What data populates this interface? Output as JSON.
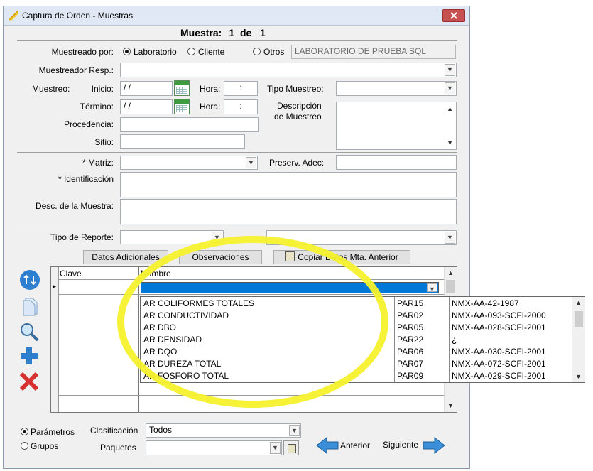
{
  "window": {
    "title": "Captura de Orden - Muestras",
    "close_icon": "close-icon"
  },
  "header": {
    "label": "Muestra:",
    "current": "1",
    "of": "de",
    "total": "1"
  },
  "muestreado_por": {
    "label": "Muestreado por:",
    "options": [
      "Laboratorio",
      "Cliente",
      "Otros"
    ],
    "selected": "Laboratorio",
    "value": "LABORATORIO DE PRUEBA SQL"
  },
  "muestreador_resp": {
    "label": "Muestreador Resp.:",
    "value": ""
  },
  "muestreo": {
    "label": "Muestreo:",
    "inicio_label": "Inicio:",
    "inicio_value": "/ /",
    "hora_label": "Hora:",
    "hora_inicio": ":",
    "termino_label": "Término:",
    "termino_value": "/ /",
    "hora_termino": ":",
    "tipo_label": "Tipo Muestreo:",
    "tipo_value": "",
    "descripcion_label_1": "Descripción",
    "descripcion_label_2": "de Muestreo"
  },
  "procedencia": {
    "label": "Procedencia:",
    "value": ""
  },
  "sitio": {
    "label": "Sitio:",
    "value": ""
  },
  "matriz": {
    "label": "* Matriz:",
    "value": ""
  },
  "preserv": {
    "label": "Preserv. Adec:",
    "value": ""
  },
  "identificacion": {
    "label": "* Identificación",
    "value": ""
  },
  "desc_muestra": {
    "label": "Desc. de la Muestra:",
    "value": ""
  },
  "tipo_reporte": {
    "label": "Tipo de Reporte:",
    "value": "",
    "value2": ""
  },
  "actions": {
    "datos_adicionales": "Datos Adicionales",
    "observaciones": "Observaciones",
    "copiar": "Copiar Datos Mta. Anterior"
  },
  "grid": {
    "columns": [
      "Clave",
      "Nombre"
    ],
    "row_indicator": "▸"
  },
  "dropdown_rows": [
    {
      "nombre": "AR COLIFORMES TOTALES",
      "clave": "PAR15",
      "norma": "NMX-AA-42-1987"
    },
    {
      "nombre": "AR CONDUCTIVIDAD",
      "clave": "PAR02",
      "norma": "NMX-AA-093-SCFI-2000"
    },
    {
      "nombre": "AR DBO",
      "clave": "PAR05",
      "norma": "NMX-AA-028-SCFI-2001"
    },
    {
      "nombre": "AR DENSIDAD",
      "clave": "PAR22",
      "norma": "¿"
    },
    {
      "nombre": "AR DQO",
      "clave": "PAR06",
      "norma": "NMX-AA-030-SCFI-2001"
    },
    {
      "nombre": "AR DUREZA TOTAL",
      "clave": "PAR07",
      "norma": "NMX-AA-072-SCFI-2001"
    },
    {
      "nombre": "AR FOSFORO TOTAL",
      "clave": "PAR09",
      "norma": "NMX-AA-029-SCFI-2001"
    }
  ],
  "bottom": {
    "radio_parametros": "Parámetros",
    "radio_grupos": "Grupos",
    "selected": "Parámetros",
    "clasificacion_label": "Clasificación",
    "clasificacion_value": "Todos",
    "paquetes_label": "Paquetes",
    "paquetes_value": "",
    "anterior": "Anterior",
    "siguiente": "Siguiente"
  },
  "colors": {
    "highlight": "#f5f12c",
    "selection": "#0078d7",
    "close": "#c75050"
  }
}
